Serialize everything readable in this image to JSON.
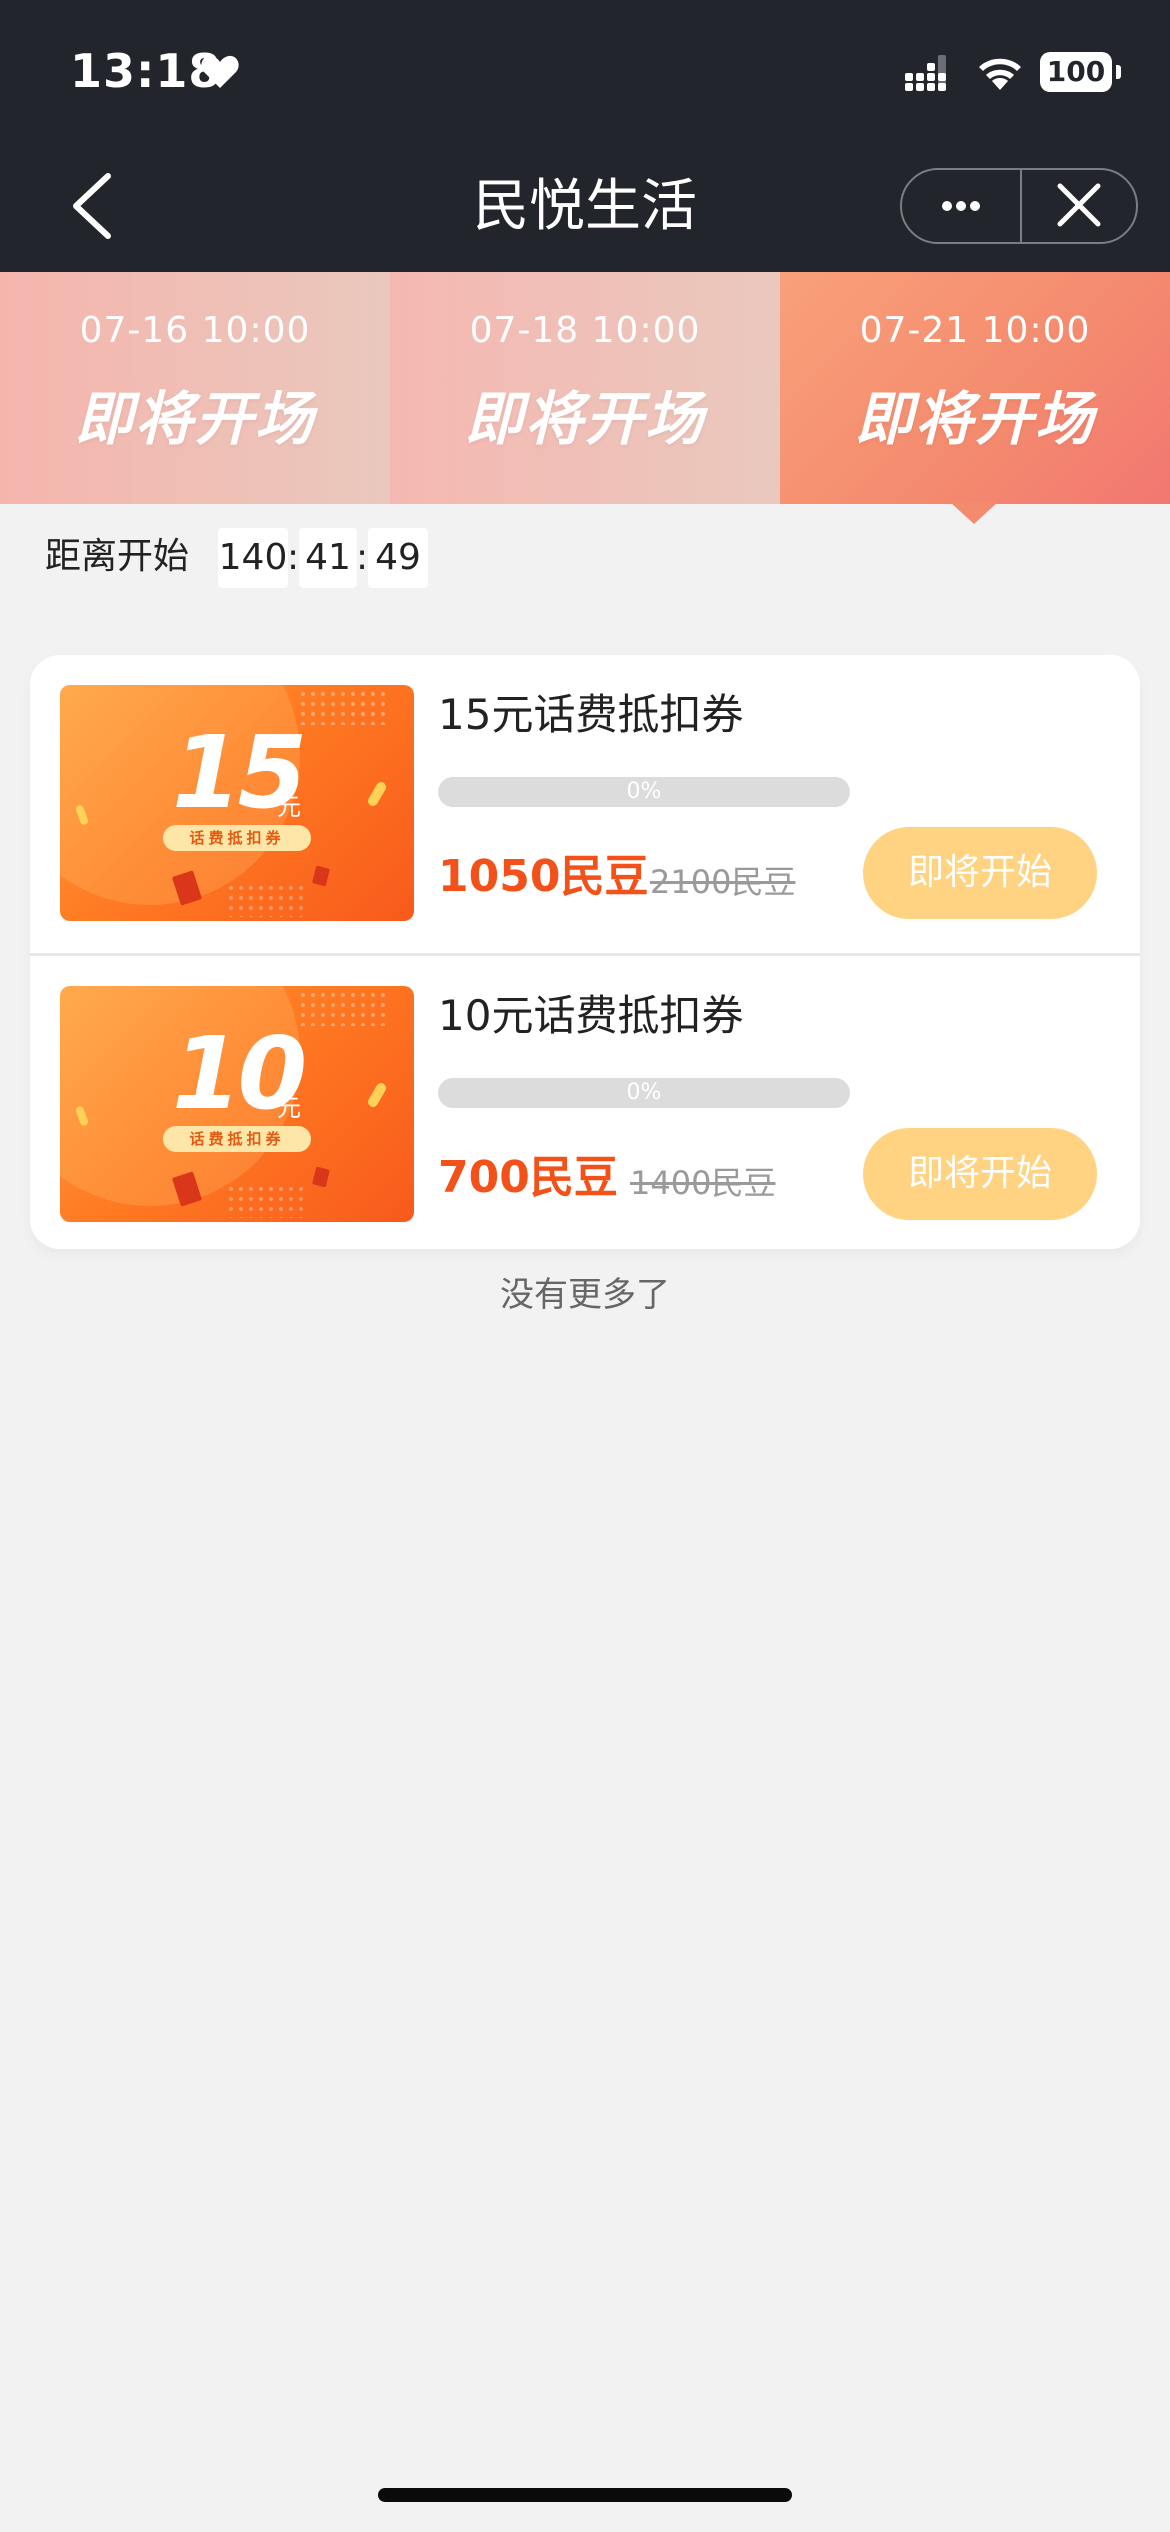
{
  "status_bar": {
    "time": "13:18",
    "battery": "100"
  },
  "nav": {
    "title": "民悦生活"
  },
  "sessions": [
    {
      "time": "07-16 10:00",
      "status": "即将开场"
    },
    {
      "time": "07-18 10:00",
      "status": "即将开场"
    },
    {
      "time": "07-21 10:00",
      "status": "即将开场"
    }
  ],
  "countdown": {
    "label": "距离开始",
    "hours": "140",
    "minutes": "41",
    "seconds": "49",
    "separator": ":"
  },
  "items": [
    {
      "thumb_value": "15",
      "thumb_unit": "元",
      "thumb_caption": "话费抵扣券",
      "title": "15元话费抵扣券",
      "progress": 0,
      "progress_text": "0%",
      "price": "1050民豆",
      "original_price": "2100民豆",
      "button": "即将开始"
    },
    {
      "thumb_value": "10",
      "thumb_unit": "元",
      "thumb_caption": "话费抵扣券",
      "title": "10元话费抵扣券",
      "progress": 0,
      "progress_text": "0%",
      "price": "700民豆",
      "original_price": "1400民豆",
      "button": "即将开始"
    }
  ],
  "footer": {
    "no_more": "没有更多了"
  },
  "colors": {
    "nav_background": "#22252b",
    "active_tab": "#f48a6e",
    "price": "#f2521a",
    "button": "#ffd382",
    "page_background": "#f2f2f2"
  }
}
